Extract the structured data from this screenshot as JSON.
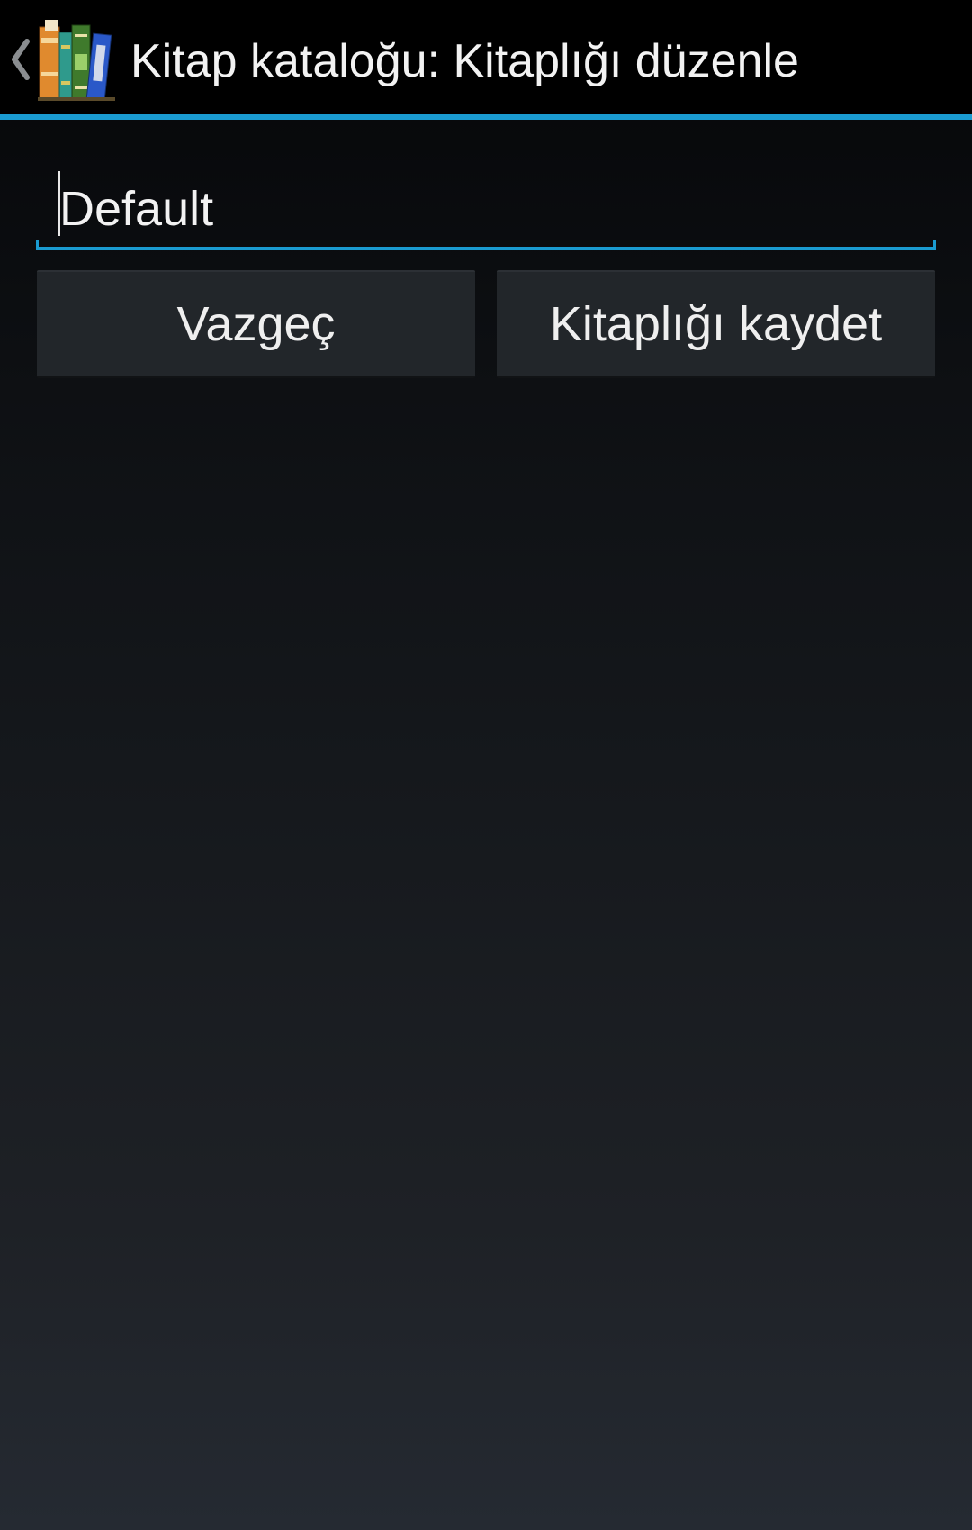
{
  "action_bar": {
    "title": "Kitap kataloğu: Kitaplığı düzenle",
    "app_icon": "books-icon",
    "up_icon": "chevron-left-icon",
    "accent_color": "#1a9bd1"
  },
  "form": {
    "name_value": "Default"
  },
  "buttons": {
    "cancel_label": "Vazgeç",
    "save_label": "Kitaplığı kaydet"
  }
}
